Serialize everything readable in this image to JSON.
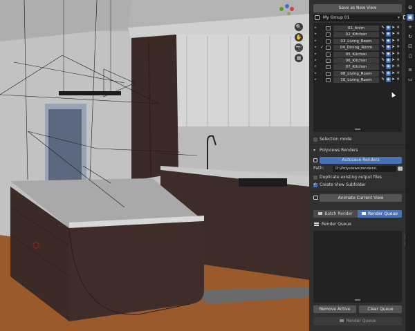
{
  "panel": {
    "save_view_label": "Save as New View",
    "group_name": "My Group 01",
    "views": [
      {
        "name": "01_Anim",
        "checked": false
      },
      {
        "name": "02_Kitchen",
        "checked": false
      },
      {
        "name": "03_Living_Room",
        "checked": false
      },
      {
        "name": "04_Dining_Room",
        "checked": true
      },
      {
        "name": "05_Kitchen",
        "checked": false
      },
      {
        "name": "06_Kitchen",
        "checked": false
      },
      {
        "name": "07_Kitchen",
        "checked": false
      },
      {
        "name": "08_Living_Room",
        "checked": false
      },
      {
        "name": "10_Living_Room",
        "checked": false
      }
    ],
    "selection_mode_label": "Selection mode",
    "renders_section_label": "Polyviews Renders",
    "autosave_label": "Autosave Renders",
    "path_label": "Path:",
    "path_value": "D:\\Polyviews\\renders\\",
    "duplicate_label": "Duplicate existing output files",
    "create_subfolder_label": "Create View Subfolder",
    "animate_label": "Animate Current View",
    "tab_batch": "Batch Render",
    "tab_queue": "Render Queue",
    "queue_header": "Render Queue",
    "remove_active_label": "Remove Active",
    "clear_queue_label": "Clear Queue",
    "render_queue_button": "Render Queue"
  },
  "icons": {
    "arrow": "▸",
    "check": "✓",
    "close": "✕",
    "pointer": "➤",
    "camera": "📷",
    "zoom": "🔍",
    "hand": "✋",
    "grid": "▦"
  },
  "colors": {
    "accent": "#4772b3",
    "panel_bg": "#303030",
    "list_bg": "#222222"
  }
}
